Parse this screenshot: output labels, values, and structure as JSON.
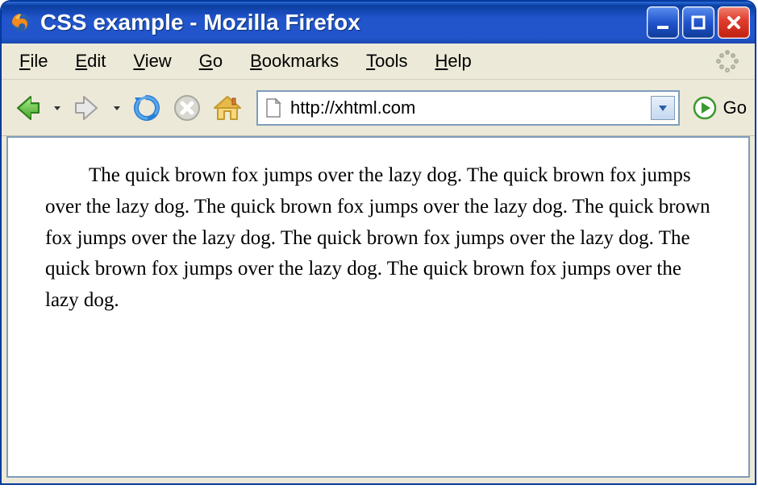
{
  "window": {
    "title": "CSS example - Mozilla Firefox"
  },
  "menubar": {
    "file": "File",
    "edit": "Edit",
    "view": "View",
    "go": "Go",
    "bookmarks": "Bookmarks",
    "tools": "Tools",
    "help": "Help"
  },
  "toolbar": {
    "url": "http://xhtml.com",
    "go_label": "Go"
  },
  "content": {
    "paragraph": "The quick brown fox jumps over the lazy dog. The quick brown fox jumps over the lazy dog. The quick brown fox jumps over the lazy dog. The quick brown fox jumps over the lazy dog. The quick brown fox jumps over the lazy dog. The quick brown fox jumps over the lazy dog. The quick brown fox jumps over the lazy dog."
  }
}
